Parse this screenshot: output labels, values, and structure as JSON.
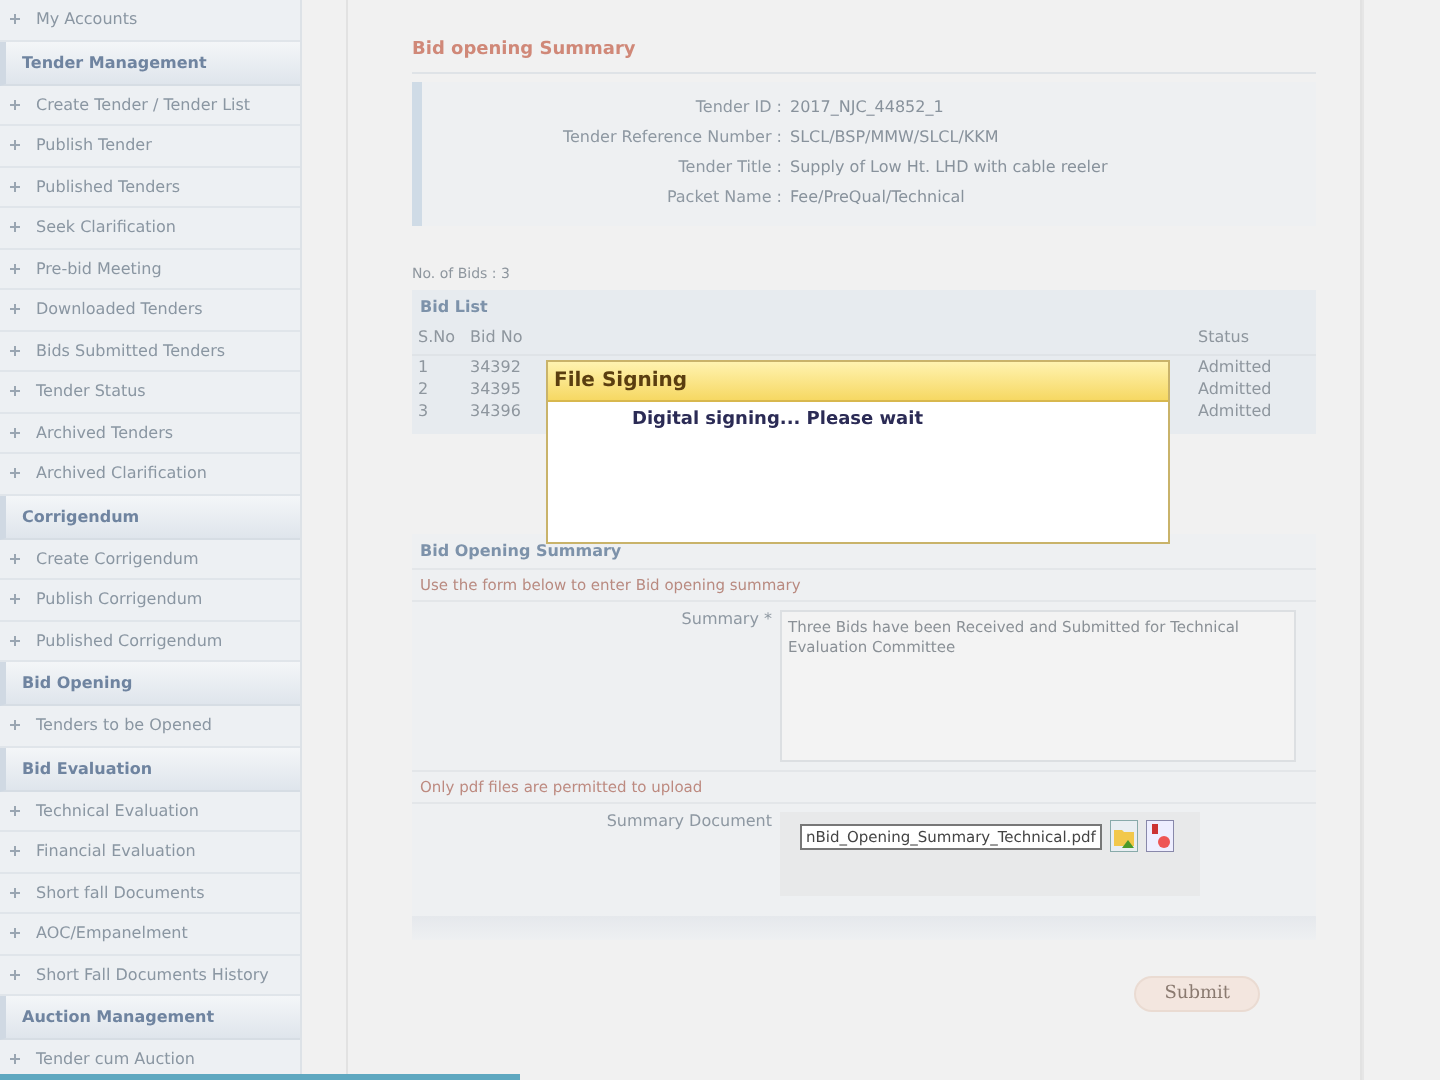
{
  "sidebar": {
    "sections": [
      {
        "items": [
          "My Accounts"
        ]
      },
      {
        "title": "Tender Management",
        "items": [
          "Create Tender / Tender List",
          "Publish Tender",
          "Published Tenders",
          "Seek Clarification",
          "Pre-bid Meeting",
          "Downloaded Tenders",
          "Bids Submitted Tenders",
          "Tender Status",
          "Archived Tenders",
          "Archived Clarification"
        ]
      },
      {
        "title": "Corrigendum",
        "items": [
          "Create Corrigendum",
          "Publish Corrigendum",
          "Published Corrigendum"
        ]
      },
      {
        "title": "Bid Opening",
        "items": [
          "Tenders to be Opened"
        ]
      },
      {
        "title": "Bid Evaluation",
        "items": [
          "Technical Evaluation",
          "Financial Evaluation",
          "Short fall Documents",
          "AOC/Empanelment",
          "Short Fall Documents History"
        ]
      },
      {
        "title": "Auction Management",
        "items": [
          "Tender cum Auction"
        ]
      }
    ]
  },
  "page_title": "Bid opening Summary",
  "details": [
    {
      "label": "Tender ID :",
      "value": "2017_NJC_44852_1"
    },
    {
      "label": "Tender Reference Number :",
      "value": "SLCL/BSP/MMW/SLCL/KKM"
    },
    {
      "label": "Tender Title :",
      "value": "Supply of Low Ht. LHD with cable reeler"
    },
    {
      "label": "Packet Name :",
      "value": "Fee/PreQual/Technical"
    }
  ],
  "bid_count": "No. of Bids : 3",
  "bid_list": {
    "title": "Bid List",
    "columns": [
      "S.No",
      "Bid No"
    ],
    "status_column": "Status",
    "rows": [
      {
        "sno": "1",
        "bid_no": "34392",
        "status": "Admitted"
      },
      {
        "sno": "2",
        "bid_no": "34395",
        "status": "Admitted"
      },
      {
        "sno": "3",
        "bid_no": "34396",
        "status": "Admitted"
      }
    ]
  },
  "summary": {
    "title": "Bid Opening Summary",
    "hint": "Use the form below to enter Bid opening summary",
    "label": "Summary *",
    "value": "Three Bids have been Received and Submitted for Technical Evaluation Committee",
    "upload_note": "Only pdf files are permitted to upload",
    "doc_label": "Summary Document",
    "file": "nBid_Opening_Summary_Technical.pdf"
  },
  "submit": "Submit",
  "dialog": {
    "title": "File Signing",
    "message": "Digital signing... Please wait"
  }
}
